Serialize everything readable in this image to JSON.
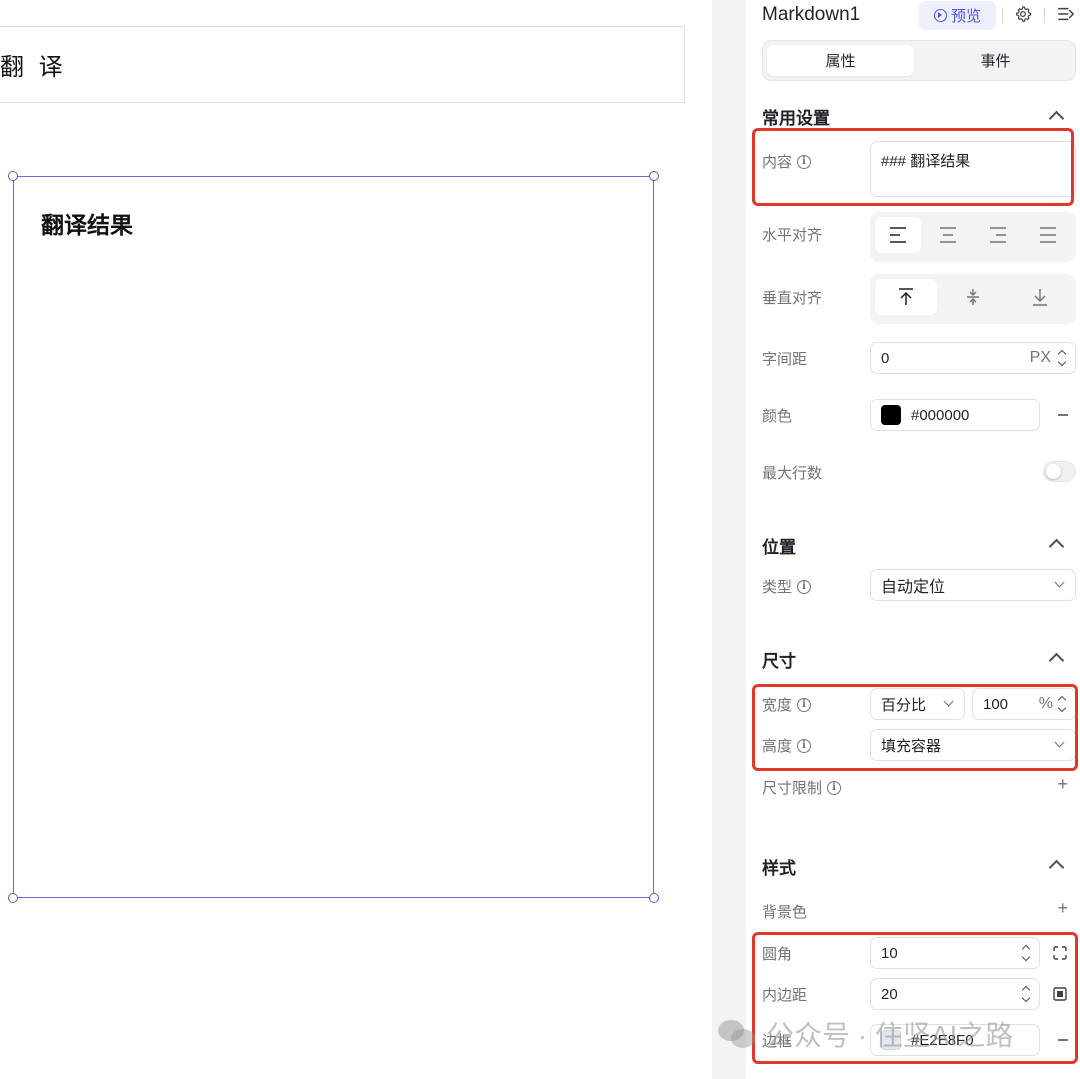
{
  "canvas": {
    "translate_button": "翻 译",
    "markdown_heading": "翻译结果"
  },
  "panel": {
    "component_name": "Markdown1",
    "preview_label": "预览",
    "tabs": {
      "properties": "属性",
      "events": "事件"
    },
    "common": {
      "title": "常用设置",
      "content_label": "内容",
      "content_value": "### 翻译结果",
      "h_align_label": "水平对齐",
      "h_align_selected": "left",
      "v_align_label": "垂直对齐",
      "v_align_selected": "top",
      "letter_spacing_label": "字间距",
      "letter_spacing_value": "0",
      "letter_spacing_unit": "PX",
      "color_label": "颜色",
      "color_value": "#000000",
      "max_lines_label": "最大行数",
      "max_lines_enabled": false
    },
    "position": {
      "title": "位置",
      "type_label": "类型",
      "type_value": "自动定位"
    },
    "size": {
      "title": "尺寸",
      "width_label": "宽度",
      "width_mode": "百分比",
      "width_value": "100",
      "width_unit": "%",
      "height_label": "高度",
      "height_value": "填充容器",
      "limit_label": "尺寸限制"
    },
    "style": {
      "title": "样式",
      "bg_label": "背景色",
      "radius_label": "圆角",
      "radius_value": "10",
      "padding_label": "内边距",
      "padding_value": "20",
      "border_label": "边框",
      "border_color": "#E2E8F0"
    }
  },
  "watermark": "公众号 · 住坚AI之路",
  "colors": {
    "accent": "#4d53e8",
    "highlight": "#e0382b",
    "selection": "#5b5bd6"
  }
}
